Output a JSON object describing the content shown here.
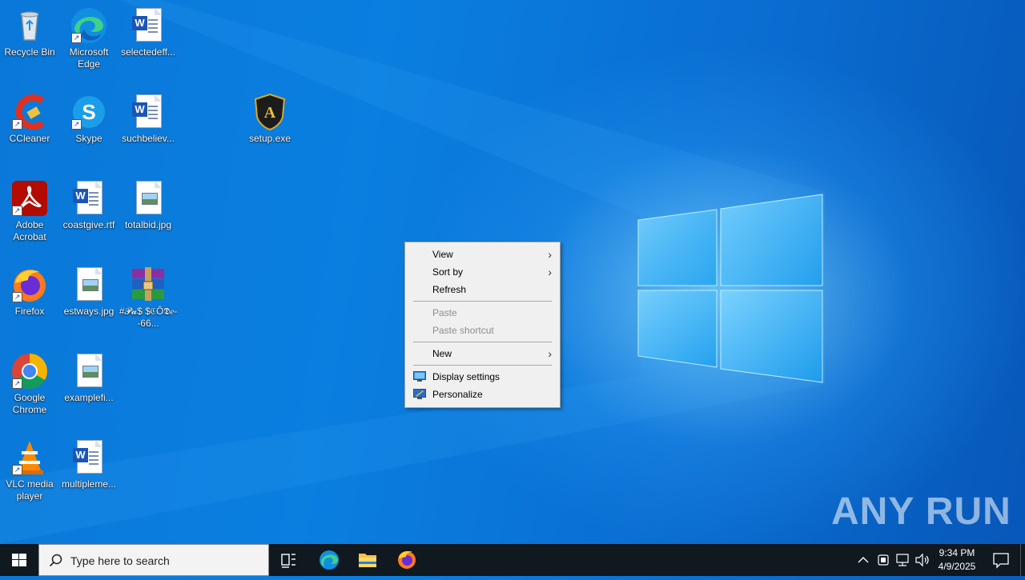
{
  "desktop": {
    "icons": [
      {
        "label": "Recycle Bin"
      },
      {
        "label": "Microsoft Edge"
      },
      {
        "label": "selectedeff..."
      },
      {
        "label": "CCleaner"
      },
      {
        "label": "Skype"
      },
      {
        "label": "suchbeliev..."
      },
      {
        "label": "setup.exe"
      },
      {
        "label": "Adobe Acrobat"
      },
      {
        "label": "coastgive.rtf"
      },
      {
        "label": "totalbid.jpg"
      },
      {
        "label": "Firefox"
      },
      {
        "label": "estways.jpg"
      },
      {
        "label": "#𝓟𝓪$ $ℭÔ𝕯𝑒--66..."
      },
      {
        "label": "Google Chrome"
      },
      {
        "label": "examplefi..."
      },
      {
        "label": "VLC media player"
      },
      {
        "label": "multipleme..."
      }
    ]
  },
  "context_menu": {
    "items": [
      {
        "label": "View",
        "submenu": true,
        "enabled": true
      },
      {
        "label": "Sort by",
        "submenu": true,
        "enabled": true
      },
      {
        "label": "Refresh",
        "submenu": false,
        "enabled": true
      },
      {
        "label": "Paste",
        "submenu": false,
        "enabled": false
      },
      {
        "label": "Paste shortcut",
        "submenu": false,
        "enabled": false
      },
      {
        "label": "New",
        "submenu": true,
        "enabled": true
      },
      {
        "label": "Display settings",
        "submenu": false,
        "enabled": true,
        "icon": "display-icon"
      },
      {
        "label": "Personalize",
        "submenu": false,
        "enabled": true,
        "icon": "personalize-icon"
      }
    ]
  },
  "taskbar": {
    "search_placeholder": "Type here to search",
    "time": "9:34 PM",
    "date": "4/9/2025"
  },
  "watermark": "ANY RUN",
  "colors": {
    "desktop_blue": "#0a78d8",
    "taskbar": "#101820",
    "menu_bg": "#f0f0f0"
  }
}
